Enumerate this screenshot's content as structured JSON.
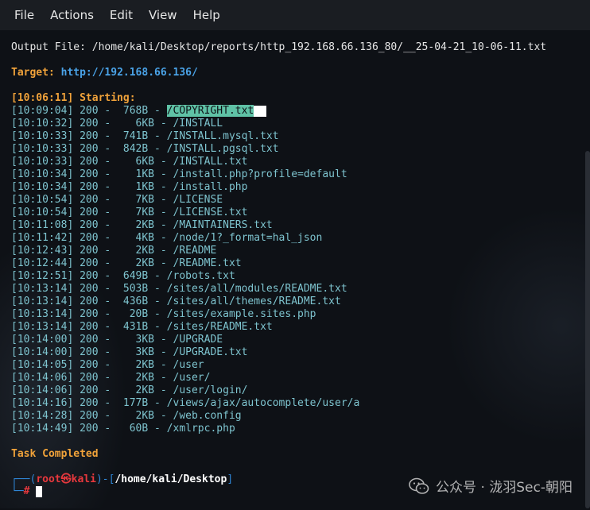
{
  "menu": {
    "items": [
      "File",
      "Actions",
      "Edit",
      "View",
      "Help"
    ]
  },
  "output_file": "Output File: /home/kali/Desktop/reports/http_192.168.66.136_80/__25-04-21_10-06-11.txt",
  "target": {
    "label": "Target:",
    "url": "http://192.168.66.136/"
  },
  "starting": "[10:06:11] Starting:",
  "results": [
    {
      "time": "[10:09:04]",
      "status": "200",
      "size": " 768B",
      "path": "/COPYRIGHT.txt"
    },
    {
      "time": "[10:10:32]",
      "status": "200",
      "size": "   6KB",
      "path": "/INSTALL"
    },
    {
      "time": "[10:10:33]",
      "status": "200",
      "size": " 741B",
      "path": "/INSTALL.mysql.txt"
    },
    {
      "time": "[10:10:33]",
      "status": "200",
      "size": " 842B",
      "path": "/INSTALL.pgsql.txt"
    },
    {
      "time": "[10:10:33]",
      "status": "200",
      "size": "   6KB",
      "path": "/INSTALL.txt"
    },
    {
      "time": "[10:10:34]",
      "status": "200",
      "size": "   1KB",
      "path": "/install.php?profile=default"
    },
    {
      "time": "[10:10:34]",
      "status": "200",
      "size": "   1KB",
      "path": "/install.php"
    },
    {
      "time": "[10:10:54]",
      "status": "200",
      "size": "   7KB",
      "path": "/LICENSE"
    },
    {
      "time": "[10:10:54]",
      "status": "200",
      "size": "   7KB",
      "path": "/LICENSE.txt"
    },
    {
      "time": "[10:11:08]",
      "status": "200",
      "size": "   2KB",
      "path": "/MAINTAINERS.txt"
    },
    {
      "time": "[10:11:42]",
      "status": "200",
      "size": "   4KB",
      "path": "/node/1?_format=hal_json"
    },
    {
      "time": "[10:12:43]",
      "status": "200",
      "size": "   2KB",
      "path": "/README"
    },
    {
      "time": "[10:12:44]",
      "status": "200",
      "size": "   2KB",
      "path": "/README.txt"
    },
    {
      "time": "[10:12:51]",
      "status": "200",
      "size": " 649B",
      "path": "/robots.txt"
    },
    {
      "time": "[10:13:14]",
      "status": "200",
      "size": " 503B",
      "path": "/sites/all/modules/README.txt"
    },
    {
      "time": "[10:13:14]",
      "status": "200",
      "size": " 436B",
      "path": "/sites/all/themes/README.txt"
    },
    {
      "time": "[10:13:14]",
      "status": "200",
      "size": "  20B",
      "path": "/sites/example.sites.php"
    },
    {
      "time": "[10:13:14]",
      "status": "200",
      "size": " 431B",
      "path": "/sites/README.txt"
    },
    {
      "time": "[10:14:00]",
      "status": "200",
      "size": "   3KB",
      "path": "/UPGRADE"
    },
    {
      "time": "[10:14:00]",
      "status": "200",
      "size": "   3KB",
      "path": "/UPGRADE.txt"
    },
    {
      "time": "[10:14:05]",
      "status": "200",
      "size": "   2KB",
      "path": "/user"
    },
    {
      "time": "[10:14:06]",
      "status": "200",
      "size": "   2KB",
      "path": "/user/"
    },
    {
      "time": "[10:14:06]",
      "status": "200",
      "size": "   2KB",
      "path": "/user/login/"
    },
    {
      "time": "[10:14:16]",
      "status": "200",
      "size": " 177B",
      "path": "/views/ajax/autocomplete/user/a"
    },
    {
      "time": "[10:14:28]",
      "status": "200",
      "size": "   2KB",
      "path": "/web.config"
    },
    {
      "time": "[10:14:49]",
      "status": "200",
      "size": "  60B",
      "path": "/xmlrpc.php"
    }
  ],
  "task_completed": "Task Completed",
  "prompt": {
    "open": "┌──(",
    "user": "root㉿kali",
    "mid": ")-[",
    "path": "/home/kali/Desktop",
    "close": "]",
    "line2": "└─",
    "hash": "#"
  },
  "watermark": "公众号 · 泷羽Sec-朝阳",
  "colors": {
    "background": "#0e1116",
    "orange": "#f0a23a",
    "blue": "#4aa3e8",
    "cyan": "#7ec4cf",
    "highlight": "#5fc2a6",
    "red": "#e8383d"
  }
}
